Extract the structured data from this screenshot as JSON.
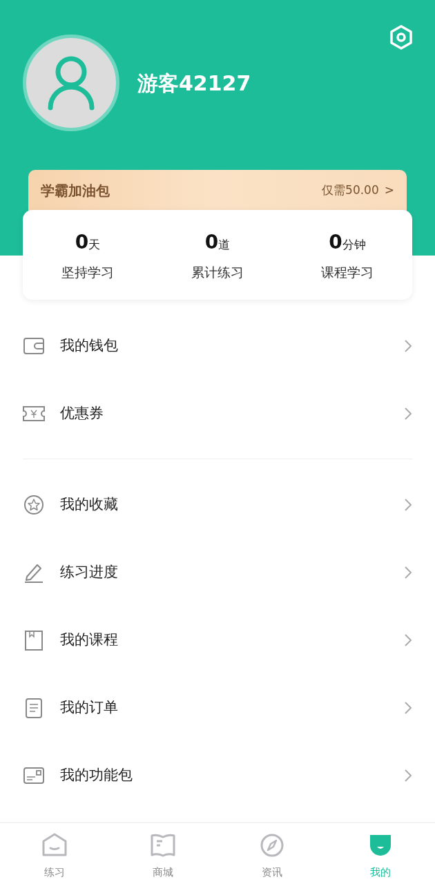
{
  "profile": {
    "username": "游客42127"
  },
  "promo": {
    "title": "学霸加油包",
    "price": "仅需50.00",
    "arrow": ">"
  },
  "stats": [
    {
      "value": "0",
      "unit": "天",
      "label": "坚持学习"
    },
    {
      "value": "0",
      "unit": "道",
      "label": "累计练习"
    },
    {
      "value": "0",
      "unit": "分钟",
      "label": "课程学习"
    }
  ],
  "menu_groups": [
    [
      {
        "label": "我的钱包"
      },
      {
        "label": "优惠券"
      }
    ],
    [
      {
        "label": "我的收藏"
      },
      {
        "label": "练习进度"
      },
      {
        "label": "我的课程"
      },
      {
        "label": "我的订单"
      },
      {
        "label": "我的功能包"
      }
    ]
  ],
  "tabs": [
    {
      "label": "练习",
      "selected": false
    },
    {
      "label": "商城",
      "selected": false
    },
    {
      "label": "资讯",
      "selected": false
    },
    {
      "label": "我的",
      "selected": true
    }
  ]
}
